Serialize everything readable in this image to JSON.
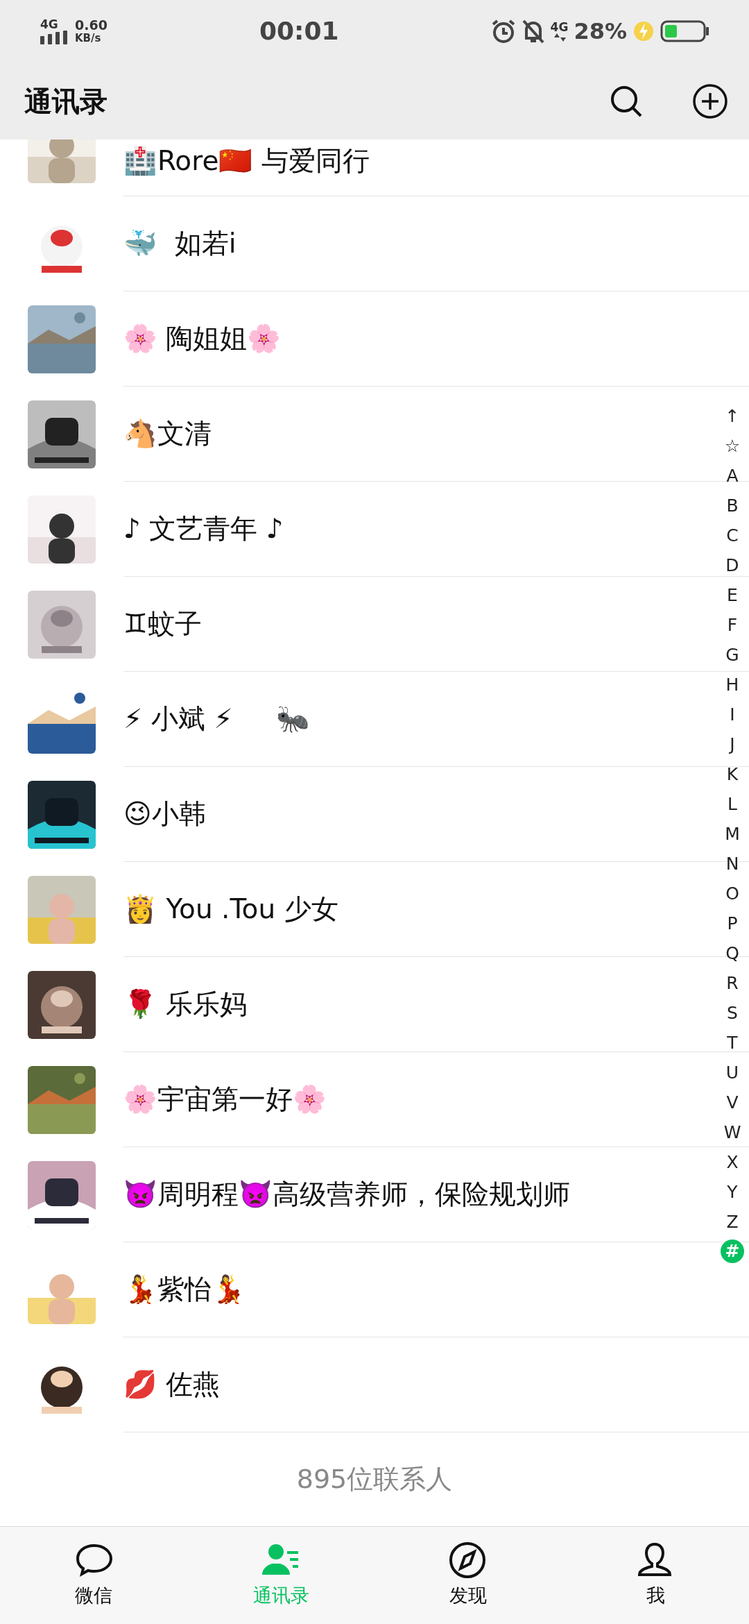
{
  "status_bar": {
    "network": "4G",
    "speed": "0.60",
    "speed_unit": "KB/s",
    "time": "00:01",
    "mobile_data": "4G",
    "battery": "28%"
  },
  "header": {
    "title": "通讯录"
  },
  "contacts": [
    {
      "name": "🏥Rore🇨🇳 与爱同行"
    },
    {
      "name": "🐳  如若i"
    },
    {
      "name": "🌸 陶姐姐🌸"
    },
    {
      "name": "🐴文清"
    },
    {
      "name": "♪ 文艺青年 ♪"
    },
    {
      "name": "♊蚊子"
    },
    {
      "name": "⚡ 小斌 ⚡     🐜"
    },
    {
      "name": "😉小韩"
    },
    {
      "name": "👸 You .Tou 少女"
    },
    {
      "name": "🌹 乐乐妈"
    },
    {
      "name": "🌸宇宙第一好🌸"
    },
    {
      "name": "👿周明程👿高级营养师，保险规划师"
    },
    {
      "name": "💃紫怡💃"
    },
    {
      "name": "💋 佐燕"
    }
  ],
  "contact_count": "895位联系人",
  "index_bar": [
    {
      "label": "↑",
      "selected": false
    },
    {
      "label": "☆",
      "selected": false
    },
    {
      "label": "A",
      "selected": false
    },
    {
      "label": "B",
      "selected": false
    },
    {
      "label": "C",
      "selected": false
    },
    {
      "label": "D",
      "selected": false
    },
    {
      "label": "E",
      "selected": false
    },
    {
      "label": "F",
      "selected": false
    },
    {
      "label": "G",
      "selected": false
    },
    {
      "label": "H",
      "selected": false
    },
    {
      "label": "I",
      "selected": false
    },
    {
      "label": "J",
      "selected": false
    },
    {
      "label": "K",
      "selected": false
    },
    {
      "label": "L",
      "selected": false
    },
    {
      "label": "M",
      "selected": false
    },
    {
      "label": "N",
      "selected": false
    },
    {
      "label": "O",
      "selected": false
    },
    {
      "label": "P",
      "selected": false
    },
    {
      "label": "Q",
      "selected": false
    },
    {
      "label": "R",
      "selected": false
    },
    {
      "label": "S",
      "selected": false
    },
    {
      "label": "T",
      "selected": false
    },
    {
      "label": "U",
      "selected": false
    },
    {
      "label": "V",
      "selected": false
    },
    {
      "label": "W",
      "selected": false
    },
    {
      "label": "X",
      "selected": false
    },
    {
      "label": "Y",
      "selected": false
    },
    {
      "label": "Z",
      "selected": false
    },
    {
      "label": "#",
      "selected": true
    }
  ],
  "tabs": [
    {
      "kind": "chat",
      "label": "微信",
      "selected": false
    },
    {
      "kind": "contacts",
      "label": "通讯录",
      "selected": true
    },
    {
      "kind": "discover",
      "label": "发现",
      "selected": false
    },
    {
      "kind": "me",
      "label": "我",
      "selected": false
    }
  ]
}
